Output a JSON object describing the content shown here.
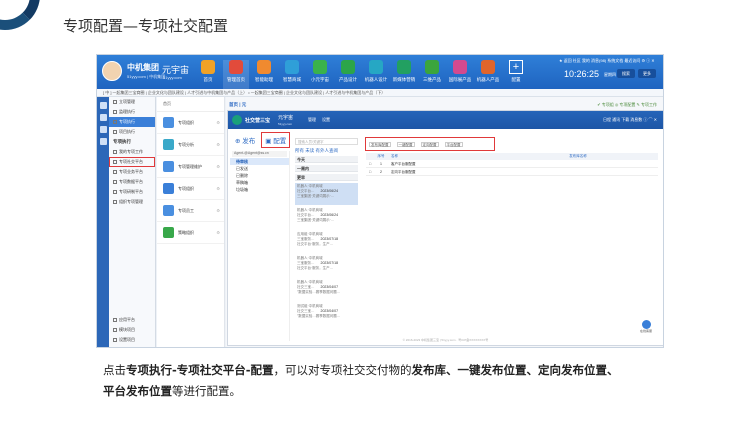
{
  "slide": {
    "title": "专项配置—专项社交配置"
  },
  "topbar": {
    "company": "中机集团",
    "company_sub": "51yyy.com | 中机集团",
    "org": "元宇宙",
    "org_sub": "51yyy.com",
    "apps": [
      {
        "label": "首页",
        "color": "#f0a227"
      },
      {
        "label": "管理首页",
        "color": "#e24b3b"
      },
      {
        "label": "智能助理",
        "color": "#f08a2f"
      },
      {
        "label": "智慧商城",
        "color": "#2f9fd8"
      },
      {
        "label": "小元宇宙",
        "color": "#3ab24b"
      },
      {
        "label": "产品设计",
        "color": "#2ca54a"
      },
      {
        "label": "机器人设计",
        "color": "#26a7c4"
      },
      {
        "label": "新媒体营销",
        "color": "#22a061"
      },
      {
        "label": "三维产品",
        "color": "#3ba53c"
      },
      {
        "label": "国际展产品",
        "color": "#d34a8f"
      },
      {
        "label": "机器人产品",
        "color": "#e0652b"
      },
      {
        "label": "配置",
        "color": "plus"
      }
    ],
    "links": "★ 返回  社区  我的  消息(98)  系统文档  最近访问  ⚙  ⓘ  ✕",
    "clock": "10:26:25",
    "clock_day": "星期四",
    "btn_search": "搜索",
    "btn_more": "更多"
  },
  "ticker": "[ 中 ] 一起集团三宝商圈 | 企业文化与团队建设 | 人才引进与中机集团与产品（上）   •   一起集团三宝商圈 | 企业文化与团队建设 | 人才引进与中机集团与产品（下）",
  "sidebar": {
    "items_top": [
      {
        "label": "立项管理",
        "active": false,
        "hl": false
      },
      {
        "label": "监理执行",
        "active": false,
        "hl": false
      },
      {
        "label": "专项执行",
        "active": true,
        "hl": false
      },
      {
        "label": "项目执行",
        "active": false,
        "hl": false
      }
    ],
    "group": "专项执行",
    "items_mid": [
      {
        "label": "我的专项工作",
        "hl": false
      },
      {
        "label": "专项社交平台",
        "hl": true
      },
      {
        "label": "专项业务平台",
        "hl": false
      },
      {
        "label": "专项数据平台",
        "hl": false
      },
      {
        "label": "专项研制平台",
        "hl": false
      },
      {
        "label": "组织专项管理",
        "hl": false
      }
    ],
    "items_bottom": [
      {
        "label": "应用平台"
      },
      {
        "label": "模块项目"
      },
      {
        "label": "设置项目"
      }
    ]
  },
  "applist": {
    "head": "首页",
    "apps": [
      {
        "label": "专项组织",
        "color": "#4a8fe0"
      },
      {
        "label": "专项分析",
        "color": "#3aa9c9"
      },
      {
        "label": "专项管理维护",
        "color": "#4a8fe0"
      },
      {
        "label": "专项组织",
        "color": "#3a7fd8"
      },
      {
        "label": "专项员工",
        "color": "#4a8fe0"
      },
      {
        "label": "策略组织",
        "color": "#38a84a"
      }
    ]
  },
  "inner": {
    "crumb": "首页 | 元",
    "tools": "✔ 专项组   ◎ 专项配置   ✎ 专项工作",
    "social": {
      "title": "社交营三宝",
      "org": "元宇宙",
      "org_sub": "51yyy.com",
      "menu": [
        "管理",
        "设置"
      ],
      "right_links": "日程  通讯  下载  消息数 ⓘ  ⌒  ✕",
      "tabs": [
        {
          "label": "⊕ 发布",
          "hl": false
        },
        {
          "label": "▣ 配置",
          "hl": true
        }
      ],
      "left_select": "Agent-@Agent@ss.cn",
      "left_items": [
        {
          "label": "待审核",
          "active": true
        },
        {
          "label": "已发送",
          "active": false
        },
        {
          "label": "已删除",
          "active": false
        },
        {
          "label": "草稿箱",
          "active": false
        },
        {
          "label": "垃圾箱",
          "active": false
        }
      ],
      "search_placeholder": "搜索人员/关键字",
      "filter": "所有  未读  有外人查阅",
      "date_groups": [
        "今天",
        "一周内",
        "更早"
      ],
      "cards": [
        {
          "line1": "机器人·中机商城",
          "line2": "社交平台…",
          "date": "2023/06/24",
          "line3": "三宝集团·关键词展示·…",
          "sel": true
        },
        {
          "line1": "机器人·中机商城",
          "line2": "社交平台…",
          "date": "2023/06/24",
          "line3": "三宝集团·关键词展示·…",
          "sel": false
        },
        {
          "line1": "应用组·中机商城",
          "line2": "三宝服务…",
          "date": "2023/07/18",
          "line3": "社交平台·服务，生产…",
          "sel": false
        },
        {
          "line1": "机器人·中机商城",
          "line2": "三宝服务…",
          "date": "2023/07/18",
          "line3": "社交平台·服务，生产…",
          "sel": false
        },
        {
          "line1": "机器人·中机商城",
          "line2": "社交三宝…",
          "date": "2023/04/07",
          "line3": "\"数据实验…赛季数据问题…",
          "sel": false
        },
        {
          "line1": "测试组·中机商城",
          "line2": "社交三宝…",
          "date": "2023/04/07",
          "line3": "\"数据实验…赛季数据问题…",
          "sel": false
        }
      ],
      "toolbar": [
        "发布库配置",
        "一键配置",
        "定向配置",
        "平台配置"
      ],
      "table_head": [
        "",
        "序号",
        "名称",
        "发布库名称"
      ],
      "rows": [
        {
          "n": "1",
          "name": "客户平台服配置",
          "lib": ""
        },
        {
          "n": "2",
          "name": "定向平台服配置",
          "lib": ""
        }
      ],
      "footer": "© 2016-2023 中机集团三宝 | 51yyy.com · 粤ICP备XXXXXXXX号",
      "help": "在线客服"
    }
  },
  "caption": {
    "p1": "点击",
    "b1": "专项执行-专项社交平台-配置",
    "p2": "，可以对专项社交交付物的",
    "b2": "发布库、一键发布位置、定向发布位置、",
    "b3": "平台发布位置",
    "p3": "等进行配置。"
  }
}
